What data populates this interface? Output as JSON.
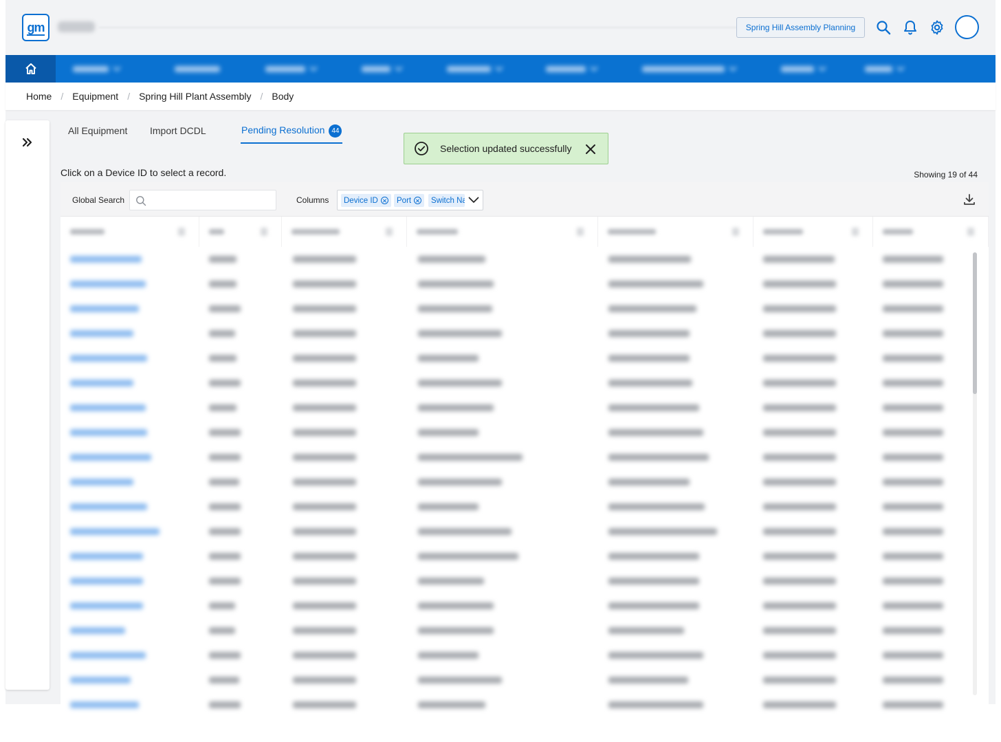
{
  "header": {
    "logo_text": "gm",
    "plant_selector": "Spring Hill Assembly Planning",
    "icons": [
      "search-icon",
      "bell-icon",
      "gear-icon",
      "user-avatar"
    ]
  },
  "nav": {
    "home_icon": "home-icon"
  },
  "breadcrumb": {
    "items": [
      "Home",
      "Equipment",
      "Spring Hill Plant Assembly",
      "Body"
    ]
  },
  "tabs": [
    {
      "label": "All Equipment"
    },
    {
      "label": "Import DCDL"
    },
    {
      "label": "Pending Resolution",
      "badge": "44",
      "active": true
    }
  ],
  "toast": {
    "message": "Selection updated successfully"
  },
  "grid": {
    "hint": "Click on a Device ID to select a record.",
    "showing": "Showing 19 of 44",
    "global_search_label": "Global Search",
    "global_search_value": "",
    "columns_label": "Columns",
    "column_chips": [
      "Device ID",
      "Port",
      "Switch Name"
    ],
    "visible_rows": 19,
    "scroll_position": 0.0
  },
  "colors": {
    "accent": "#0b6fd1",
    "nav_bg": "#0a72d1",
    "nav_home_bg": "#0a59a9",
    "toast_bg": "#d6f0cf",
    "page_bg": "#f2f3f5"
  }
}
